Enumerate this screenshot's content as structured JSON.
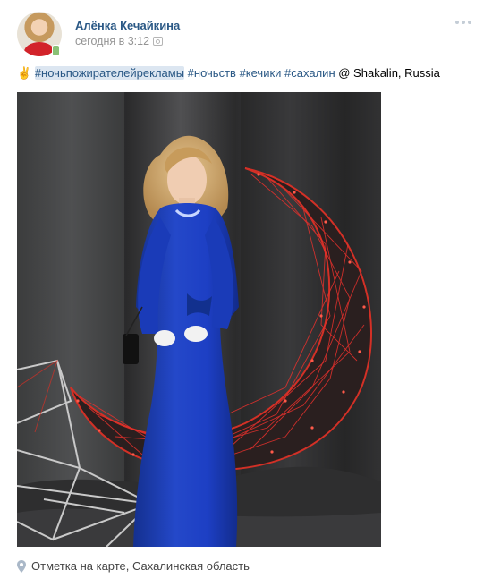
{
  "post": {
    "author": "Алёнка Кечайкина",
    "date": "сегодня в 3:12",
    "text_emoji": "✌️",
    "hashtags": [
      "#ночьпожирателейрекламы",
      "#ночьств",
      "#кечики",
      "#сахалин"
    ],
    "location_prefix": "@ Shakalin, Russia",
    "geo_label": "Отметка на карте, Сахалинская область"
  },
  "colors": {
    "link": "#2a5885",
    "tag_highlight": "#dce6f1",
    "secondary_text": "#939393",
    "dress": "#1d3fc4",
    "moon_lights": "#e8312d"
  },
  "icons": {
    "online": "mobile-online-icon",
    "camera": "camera-icon",
    "more": "more-dots-icon",
    "geo": "map-pin-icon"
  }
}
